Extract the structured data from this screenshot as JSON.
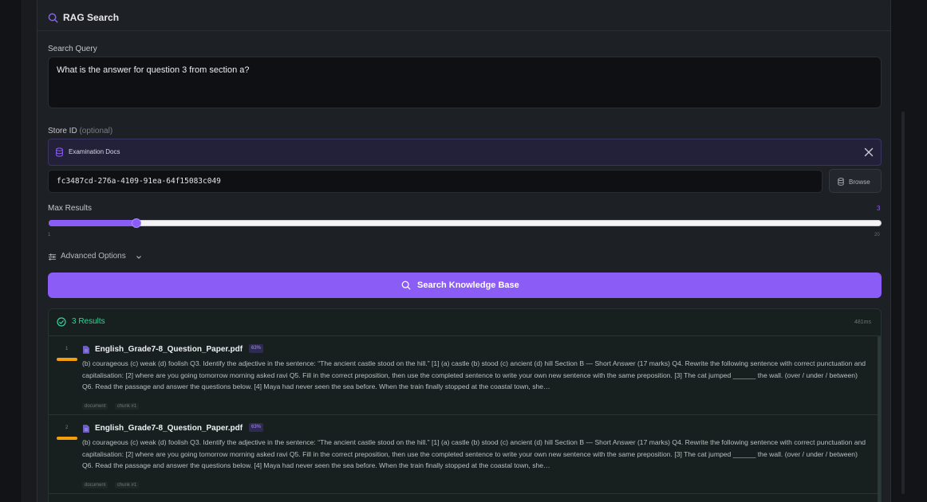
{
  "panel": {
    "title": "RAG Search"
  },
  "query": {
    "label": "Search Query",
    "value": "What is the answer for question 3 from section a?"
  },
  "store": {
    "label": "Store ID",
    "optional_label": "(optional)",
    "selected_name": "Examination Docs",
    "id_value": "fc3487cd-276a-4109-91ea-64f15083c049",
    "browse_label": "Browse"
  },
  "max_results": {
    "label": "Max Results",
    "value": 3,
    "display": "3",
    "min": "1",
    "max": "20",
    "min_value": 1,
    "max_value": 20
  },
  "advanced": {
    "label": "Advanced Options"
  },
  "search_button": {
    "label": "Search Knowledge Base"
  },
  "results": {
    "count_label": "3 Results",
    "time": "481ms",
    "items": [
      {
        "rank": "1",
        "file": "English_Grade7-8_Question_Paper.pdf",
        "score": "63%",
        "snippet": "(b) courageous (c) weak (d) foolish Q3. Identify the adjective in the sentence: “The ancient castle stood on the hill.” [1] (a) castle (b) stood (c) ancient (d) hill Section B — Short Answer (17 marks) Q4. Rewrite the following sentence with correct punctuation and capitalisation: [2] where are you going tomorrow morning asked ravi Q5. Fill in the correct preposition, then use the completed sentence to write your own new sentence with the same preposition. [3] The cat jumped ______ the wall. (over / under / between) Q6. Read the passage and answer the questions below. [4] Maya had never seen the sea before. When the train finally stopped at the coastal town, she…",
        "tags": [
          "document",
          "chunk #1"
        ]
      },
      {
        "rank": "2",
        "file": "English_Grade7-8_Question_Paper.pdf",
        "score": "63%",
        "snippet": "(b) courageous (c) weak (d) foolish Q3. Identify the adjective in the sentence: “The ancient castle stood on the hill.” [1] (a) castle (b) stood (c) ancient (d) hill Section B — Short Answer (17 marks) Q4. Rewrite the following sentence with correct punctuation and capitalisation: [2] where are you going tomorrow morning asked ravi Q5. Fill in the correct preposition, then use the completed sentence to write your own new sentence with the same preposition. [3] The cat jumped ______ the wall. (over / under / between) Q6. Read the passage and answer the questions below. [4] Maya had never seen the sea before. When the train finally stopped at the coastal town, she…",
        "tags": [
          "document",
          "chunk #1"
        ]
      }
    ]
  },
  "colors": {
    "accent": "#8b5cf6",
    "success": "#34d399",
    "relevance_bar": "#f59e0b"
  }
}
